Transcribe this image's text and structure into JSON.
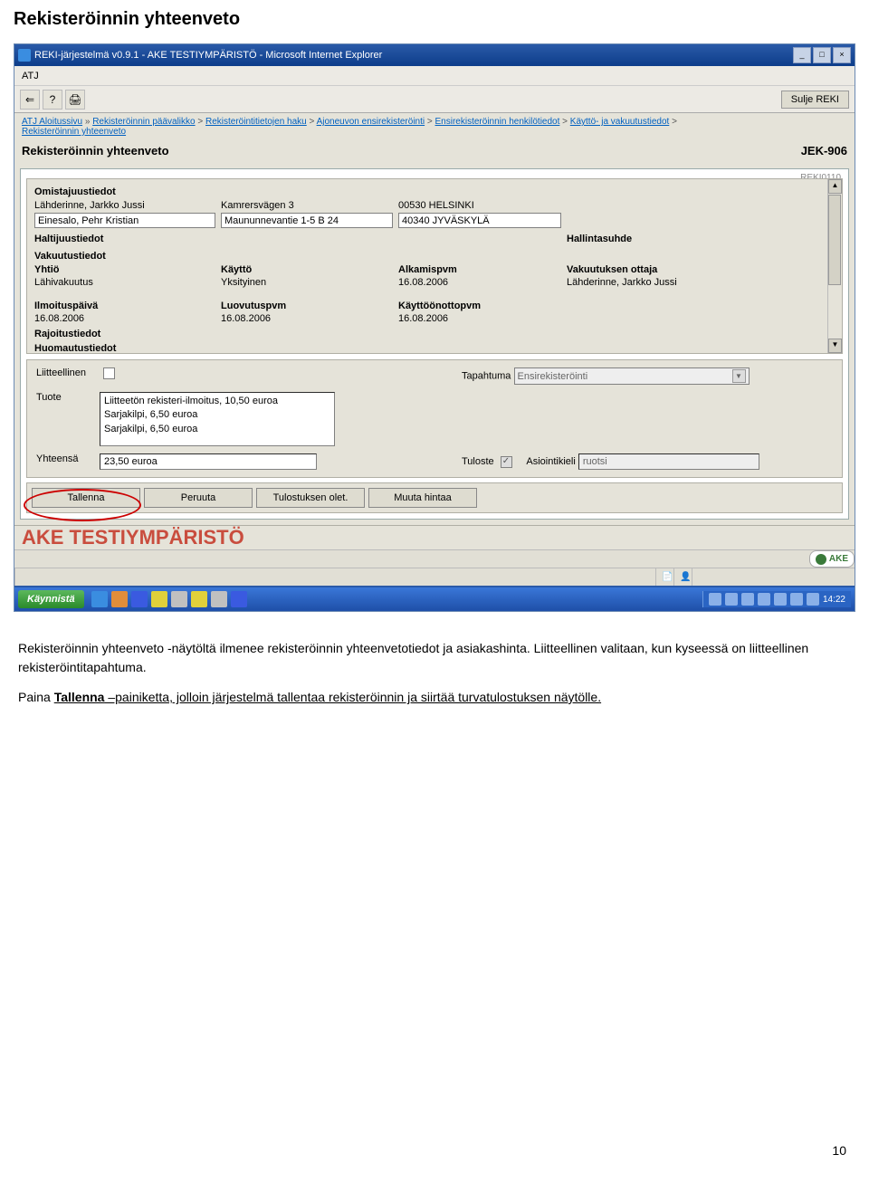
{
  "doc": {
    "heading": "Rekisteröinnin yhteenveto",
    "para1": "Rekisteröinnin yhteenveto -näytöltä ilmenee rekisteröinnin yhteenvetotiedot ja asiakashinta. Liitteellinen valitaan, kun kyseessä on liitteellinen rekisteröintitapahtuma.",
    "para2a": "Paina ",
    "para2b": "Tallenna",
    "para2c": " –painiketta, jolloin järjestelmä tallentaa rekisteröinnin ja siirtää turvatulostuksen näytölle.",
    "page_num": "10"
  },
  "window": {
    "title": "REKI-järjestelmä v0.9.1 - AKE TESTIYMPÄRISTÖ - Microsoft Internet Explorer",
    "menu": "ATJ",
    "close_label": "Sulje REKI"
  },
  "breadcrumb": {
    "home": "ATJ Aloitussivu",
    "items": [
      "Rekisteröinnin päävalikko",
      "Rekisteröintitietojen haku",
      "Ajoneuvon ensirekisteröinti",
      "Ensirekisteröinnin henkilötiedot",
      "Käyttö- ja vakuutustiedot"
    ],
    "last": "Rekisteröinnin yhteenveto"
  },
  "page": {
    "title": "Rekisteröinnin yhteenveto",
    "reg": "JEK-906",
    "code": "REKI0110"
  },
  "sections": {
    "omistajuus": {
      "title": "Omistajuustiedot",
      "r1": {
        "c1": "Lähderinne, Jarkko Jussi",
        "c2": "Kamrersvägen 3",
        "c3": "00530 HELSINKI"
      },
      "r2": {
        "c1": "Einesalo, Pehr Kristian",
        "c2": "Maununnevantie 1-5 B 24",
        "c3": "40340 JYVÄSKYLÄ"
      }
    },
    "haltijuus": {
      "title": "Haltijuustiedot",
      "hallinta": "Hallintasuhde"
    },
    "vakuutus": {
      "title": "Vakuutustiedot",
      "h": {
        "c1": "Yhtiö",
        "c2": "Käyttö",
        "c3": "Alkamispvm",
        "c4": "Vakuutuksen ottaja"
      },
      "r": {
        "c1": "Lähivakuutus",
        "c2": "Yksityinen",
        "c3": "16.08.2006",
        "c4": "Lähderinne, Jarkko Jussi"
      }
    },
    "dates": {
      "h": {
        "c1": "Ilmoituspäivä",
        "c2": "Luovutuspvm",
        "c3": "Käyttöönottopvm"
      },
      "r": {
        "c1": "16.08.2006",
        "c2": "16.08.2006",
        "c3": "16.08.2006"
      }
    },
    "rajoitus": "Rajoitustiedot",
    "huom": "Huomautustiedot"
  },
  "lower": {
    "liitteellinen": "Liitteellinen",
    "tapahtuma_label": "Tapahtuma",
    "tapahtuma_value": "Ensirekisteröinti",
    "tuote_label": "Tuote",
    "products": [
      "Liitteetön rekisteri-ilmoitus, 10,50 euroa",
      "Sarjakilpi, 6,50 euroa",
      "Sarjakilpi, 6,50 euroa"
    ],
    "yhteensa_label": "Yhteensä",
    "yhteensa_value": "23,50 euroa",
    "tuloste_label": "Tuloste",
    "asiointikieli_label": "Asiointikieli",
    "asiointikieli_value": "ruotsi"
  },
  "buttons": {
    "b1": "Tallenna",
    "b2": "Peruuta",
    "b3": "Tulostuksen olet.",
    "b4": "Muuta hintaa"
  },
  "watermark": "AKE TESTIYMPÄRISTÖ",
  "ake": "AKE",
  "taskbar": {
    "start": "Käynnistä",
    "time": "14:22"
  }
}
